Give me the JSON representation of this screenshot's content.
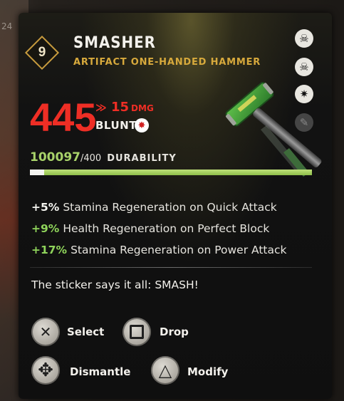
{
  "background_text": "24",
  "item": {
    "level": "9",
    "name": "SMASHER",
    "type": "ARTIFACT ONE-HANDED HAMMER"
  },
  "side_icons": [
    {
      "name": "skull-crossbones-icon",
      "glyph": "☠"
    },
    {
      "name": "skull-crossbones-icon",
      "glyph": "☠"
    },
    {
      "name": "gear-icon",
      "glyph": "✷"
    },
    {
      "name": "wrench-icon",
      "glyph": "✎"
    }
  ],
  "damage": {
    "value": "445",
    "diff_arrow": "≫",
    "diff": "15",
    "diff_unit": "DMG",
    "type": "BLUNT",
    "type_icon": "💥"
  },
  "durability": {
    "current": "100097",
    "max": "/400",
    "label": "DURABILITY",
    "fill_fraction": 1.0
  },
  "stats": [
    {
      "value": "+5%",
      "text": "Stamina Regeneration on Quick Attack",
      "color": "white"
    },
    {
      "value": "+9%",
      "text": "Health Regeneration on Perfect Block",
      "color": "green"
    },
    {
      "value": "+17%",
      "text": "Stamina Regeneration on Power Attack",
      "color": "green"
    }
  ],
  "description": "The sticker says it all: SMASH!",
  "actions": {
    "select": {
      "label": "Select",
      "glyph": "✕"
    },
    "drop": {
      "label": "Drop"
    },
    "dismantle": {
      "label": "Dismantle",
      "glyph": "✥"
    },
    "modify": {
      "label": "Modify",
      "glyph": "△"
    }
  }
}
